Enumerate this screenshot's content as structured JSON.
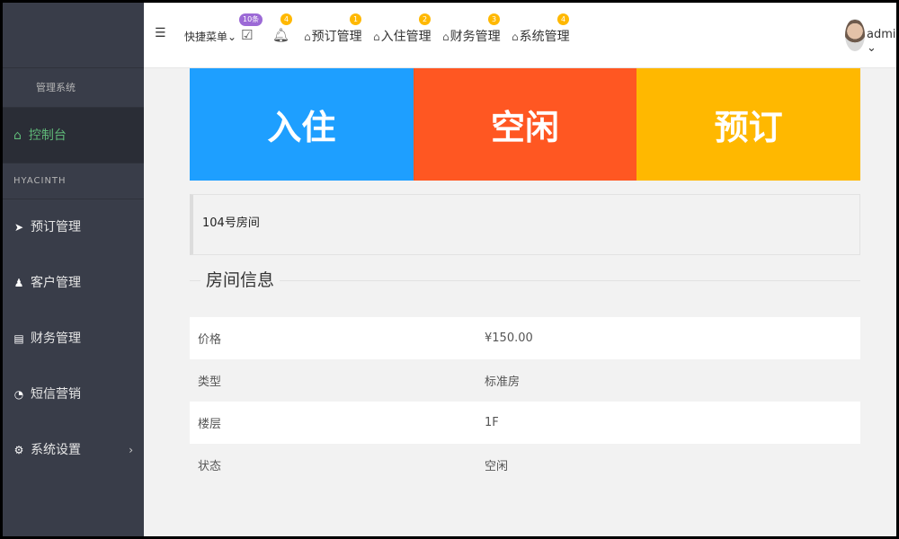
{
  "sidebar": {
    "title": "管理系统",
    "console": "控制台",
    "group": "HYACINTH",
    "items": [
      {
        "label": "预订管理",
        "icon": "paper-plane-icon"
      },
      {
        "label": "客户管理",
        "icon": "person-icon"
      },
      {
        "label": "财务管理",
        "icon": "card-icon"
      },
      {
        "label": "短信营销",
        "icon": "chat-icon"
      },
      {
        "label": "系统设置",
        "icon": "gears-icon"
      }
    ]
  },
  "header": {
    "quick_menu": "快捷菜单",
    "todo_badge": "10条",
    "bell_badge": "4",
    "nav": [
      {
        "label": "预订管理",
        "badge": "1"
      },
      {
        "label": "入住管理",
        "badge": "2"
      },
      {
        "label": "财务管理",
        "badge": "3"
      },
      {
        "label": "系统管理",
        "badge": "4"
      }
    ],
    "user": "admin"
  },
  "status": {
    "checkin": {
      "label": "入住",
      "color": "#1e9fff"
    },
    "free": {
      "label": "空闲",
      "color": "#ff5722"
    },
    "booked": {
      "label": "预订",
      "color": "#ffb800"
    }
  },
  "room": {
    "name": "104号房间",
    "section_title": "房间信息",
    "info": [
      {
        "key": "价格",
        "value": "¥150.00"
      },
      {
        "key": "类型",
        "value": "标准房"
      },
      {
        "key": "楼层",
        "value": "1F"
      },
      {
        "key": "状态",
        "value": "空闲"
      }
    ]
  }
}
